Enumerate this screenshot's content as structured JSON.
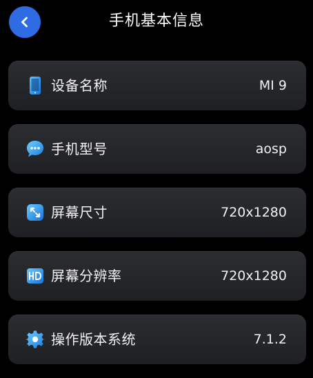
{
  "header": {
    "title": "手机基本信息"
  },
  "items": [
    {
      "label": "设备名称",
      "value": "MI 9",
      "icon": "phone-icon"
    },
    {
      "label": "手机型号",
      "value": "aosp",
      "icon": "chat-bubble-icon"
    },
    {
      "label": "屏幕尺寸",
      "value": "720x1280",
      "icon": "screen-size-icon"
    },
    {
      "label": "屏幕分辨率",
      "value": "720x1280",
      "icon": "hd-icon"
    },
    {
      "label": "操作版本系统",
      "value": "7.1.2",
      "icon": "gear-icon"
    }
  ],
  "colors": {
    "accent": "#2f6be3",
    "card_background": "#26282b",
    "icon_blue": "#3aa0f0"
  }
}
